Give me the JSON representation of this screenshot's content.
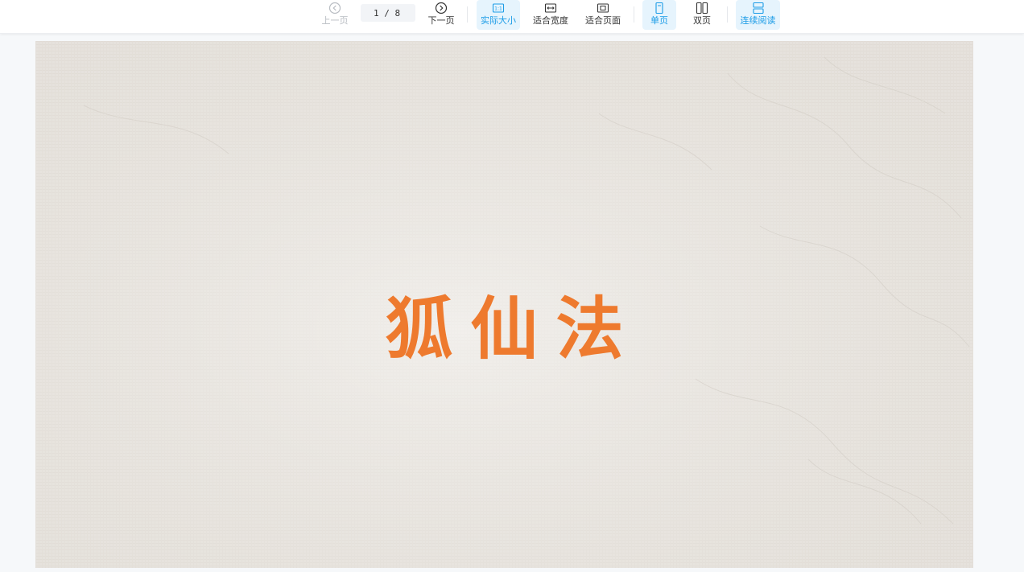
{
  "toolbar": {
    "prev_label": "上一页",
    "page_indicator": "1 / 8",
    "next_label": "下一页",
    "actual_size_label": "实际大小",
    "fit_width_label": "适合宽度",
    "fit_page_label": "适合页面",
    "single_page_label": "单页",
    "double_page_label": "双页",
    "continuous_label": "连续阅读"
  },
  "document": {
    "title": "狐仙法"
  },
  "colors": {
    "accent": "#1a9be6",
    "active_bg": "#e6f4fd",
    "title": "#ee7a2e",
    "paper": "#ebe8e3"
  }
}
